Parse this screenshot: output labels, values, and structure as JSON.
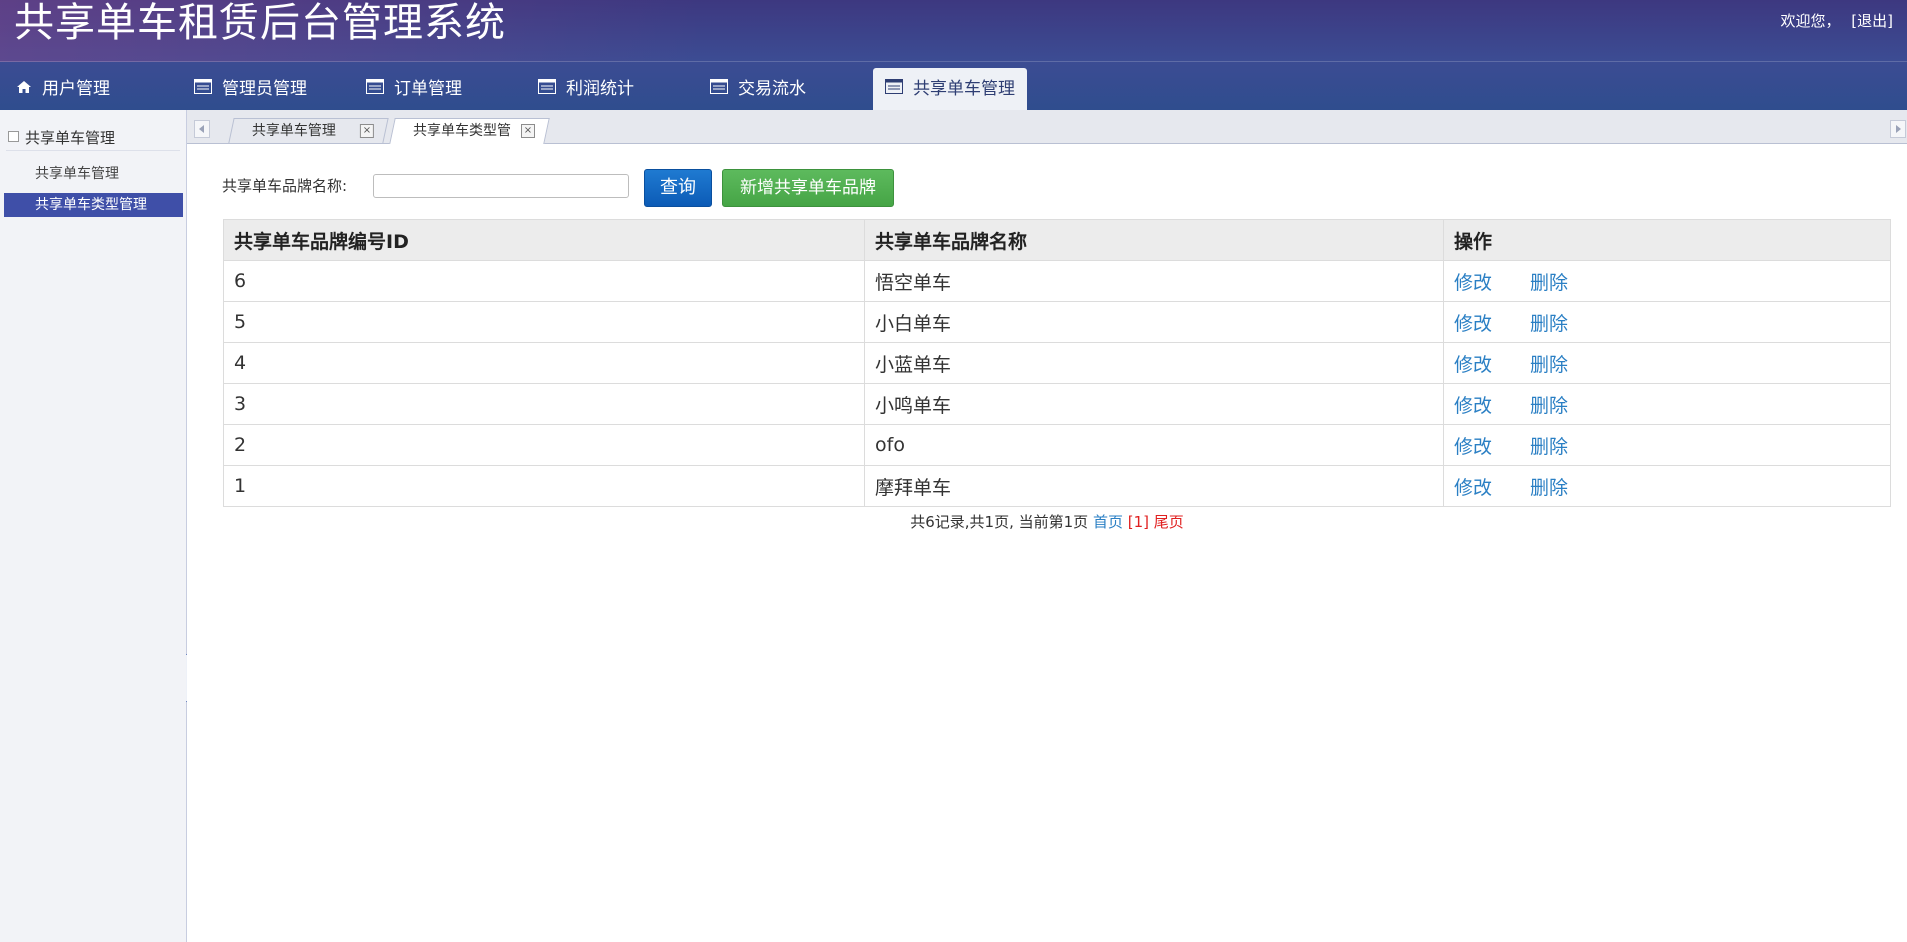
{
  "header": {
    "title": "共享单车租赁后台管理系统",
    "welcome": "欢迎您，",
    "logout": "[退出]"
  },
  "topnav": {
    "items": [
      {
        "label": "用户管理",
        "icon": "home-icon"
      },
      {
        "label": "管理员管理",
        "icon": "list-icon"
      },
      {
        "label": "订单管理",
        "icon": "list-icon"
      },
      {
        "label": "利润统计",
        "icon": "list-icon"
      },
      {
        "label": "交易流水",
        "icon": "list-icon"
      },
      {
        "label": "共享单车管理",
        "icon": "list-icon"
      }
    ],
    "active_index": 5
  },
  "sidebar": {
    "group": "共享单车管理",
    "items": [
      {
        "label": "共享单车管理"
      },
      {
        "label": "共享单车类型管理"
      }
    ],
    "active_index": 1
  },
  "tabs": {
    "items": [
      {
        "label": "共享单车管理",
        "close": "×"
      },
      {
        "label": "共享单车类型管",
        "close": "×"
      }
    ],
    "active_index": 1
  },
  "search": {
    "label": "共享单车品牌名称:",
    "value": "",
    "placeholder": "",
    "query_label": "查询",
    "add_label": "新增共享单车品牌"
  },
  "table": {
    "headers": [
      "共享单车品牌编号ID",
      "共享单车品牌名称",
      "操作"
    ],
    "rows": [
      {
        "id": "6",
        "name": "悟空单车"
      },
      {
        "id": "5",
        "name": "小白单车"
      },
      {
        "id": "4",
        "name": "小蓝单车"
      },
      {
        "id": "3",
        "name": "小鸣单车"
      },
      {
        "id": "2",
        "name": "ofo"
      },
      {
        "id": "1",
        "name": "摩拜单车"
      }
    ],
    "edit_label": "修改",
    "delete_label": "删除"
  },
  "pager": {
    "summary": "共6记录,共1页, 当前第1页",
    "first": "首页",
    "current": "[1]",
    "last": "尾页"
  },
  "colors": {
    "header_bg": "#3c4c93",
    "sidebar_active": "#3f4fa8",
    "link": "#2a7fc4",
    "query_button": "#0c5bb6",
    "add_button": "#46a546",
    "pager_current": "#e02020"
  }
}
